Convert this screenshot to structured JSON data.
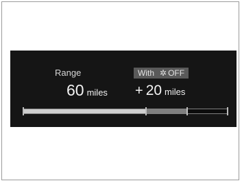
{
  "display": {
    "range_label": "Range",
    "with_label": "With",
    "off_label": "OFF",
    "climate_icon": "fan-icon",
    "range_value": "60",
    "range_unit": "miles",
    "plus_sign": "+",
    "extra_value": "20",
    "extra_unit": "miles"
  },
  "range_bar": {
    "current_fraction": 0.6,
    "extra_fraction": 0.2
  },
  "colors": {
    "screen_background": "#151515",
    "bar_fill": "#cfcfcf",
    "bar_extra": "#7f7f7f",
    "badge_background": "#5a5a5a"
  }
}
